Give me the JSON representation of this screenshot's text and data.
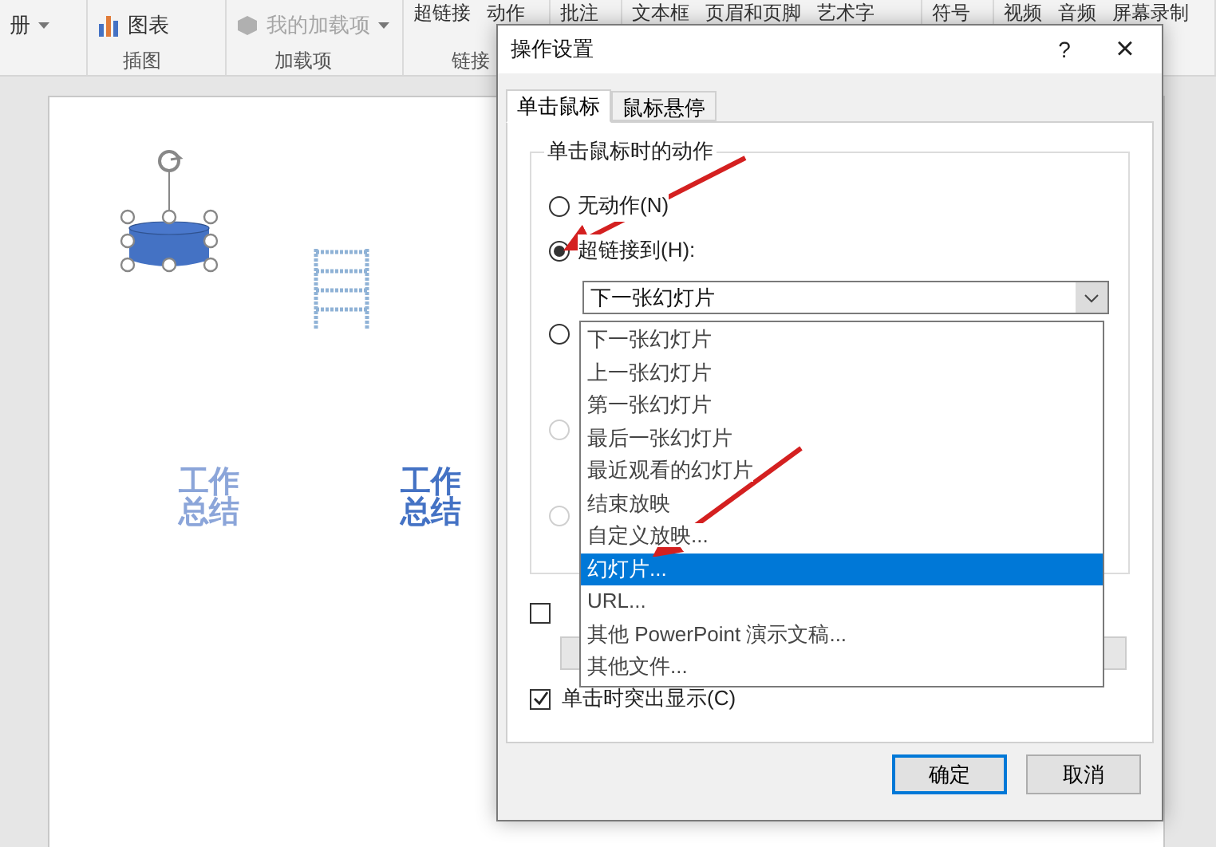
{
  "ribbon": {
    "groups": [
      {
        "items": [
          {
            "text": "册",
            "kind": "dropdown",
            "disabled": false
          }
        ]
      },
      {
        "label": "插图",
        "items": [
          {
            "text": "图表",
            "kind": "chart",
            "disabled": false
          }
        ]
      },
      {
        "label": "加载项",
        "items": [
          {
            "text": "我的加载项",
            "kind": "addin",
            "disabled": true
          }
        ]
      },
      {
        "label": "链接",
        "items": [
          {
            "text": "超链接",
            "kind": "large",
            "disabled": false
          },
          {
            "text": "动作",
            "kind": "large",
            "disabled": false
          }
        ]
      },
      {
        "items": [
          {
            "text": "批注",
            "kind": "large",
            "disabled": false
          }
        ]
      },
      {
        "items": [
          {
            "text": "文本框",
            "kind": "large",
            "disabled": false
          },
          {
            "text": "页眉和页脚",
            "kind": "large",
            "disabled": false
          },
          {
            "text": "艺术字",
            "kind": "large",
            "disabled": false
          }
        ]
      },
      {
        "items": [
          {
            "text": "符号",
            "kind": "large",
            "disabled": false
          }
        ]
      },
      {
        "items": [
          {
            "text": "视频",
            "kind": "large",
            "disabled": false
          },
          {
            "text": "音频",
            "kind": "large",
            "disabled": false
          },
          {
            "text": "屏幕录制",
            "kind": "large",
            "disabled": false
          }
        ]
      }
    ]
  },
  "slide": {
    "texts": [
      {
        "text": "工作总结",
        "kind": "outlined"
      },
      {
        "text": "工作总结",
        "kind": "bold"
      }
    ]
  },
  "dialog": {
    "title": "操作设置",
    "help": "?",
    "close": "×",
    "tabs": [
      {
        "label": "单击鼠标",
        "selected": true
      },
      {
        "label": "鼠标悬停",
        "selected": false
      }
    ],
    "group_title": "单击鼠标时的动作",
    "radios": [
      {
        "label": "无动作(N)",
        "selected": false,
        "disabled": false
      },
      {
        "label": "超链接到(H):",
        "selected": true,
        "disabled": false
      },
      {
        "selected": false,
        "disabled": false
      },
      {
        "selected": false,
        "disabled": true
      },
      {
        "selected": false,
        "disabled": true
      }
    ],
    "hyperlink_select": {
      "value": "下一张幻灯片",
      "expanded": true
    },
    "dropdown_options": [
      {
        "label": "下一张幻灯片",
        "selected": false
      },
      {
        "label": "上一张幻灯片",
        "selected": false
      },
      {
        "label": "第一张幻灯片",
        "selected": false
      },
      {
        "label": "最后一张幻灯片",
        "selected": false
      },
      {
        "label": "最近观看的幻灯片",
        "selected": false
      },
      {
        "label": "结束放映",
        "selected": false
      },
      {
        "label": "自定义放映...",
        "selected": false
      },
      {
        "label": "幻灯片...",
        "selected": true
      },
      {
        "label": "URL...",
        "selected": false
      },
      {
        "label": "其他 PowerPoint 演示文稿...",
        "selected": false
      },
      {
        "label": "其他文件...",
        "selected": false
      }
    ],
    "checkboxes": [
      {
        "checked": false
      },
      {
        "label": "单击时突出显示(C)",
        "checked": true
      }
    ],
    "buttons": [
      {
        "label": "确定",
        "default": true
      },
      {
        "label": "取消",
        "default": false
      }
    ]
  }
}
